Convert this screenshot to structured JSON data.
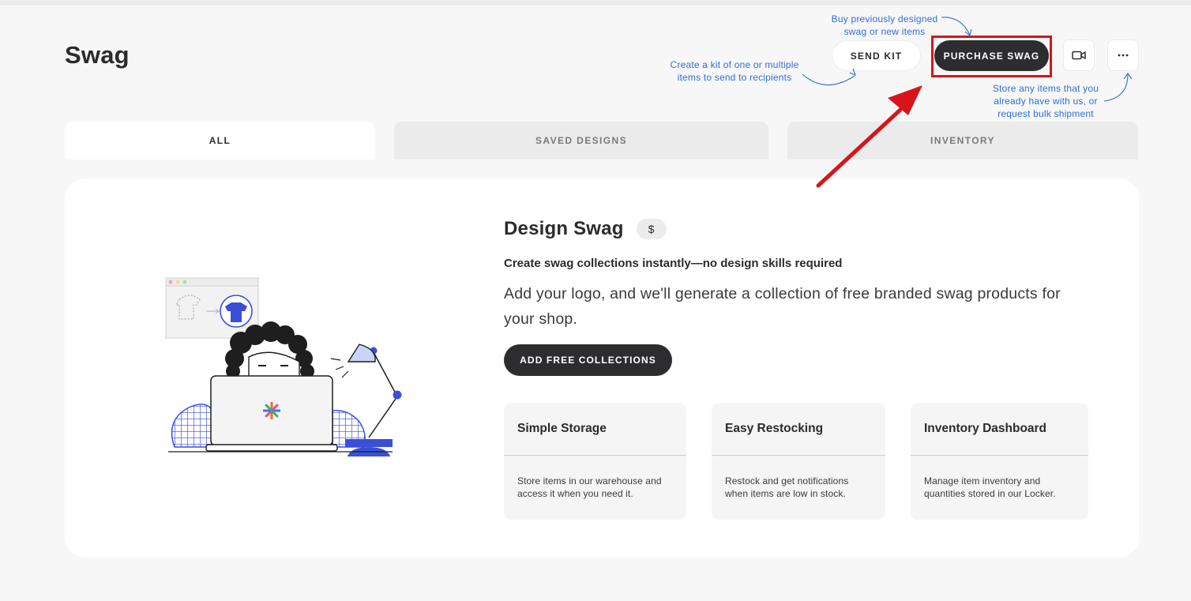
{
  "page": {
    "title": "Swag"
  },
  "hints": {
    "send_kit": "Create a kit of one or multiple items to send to recipients",
    "purchase": "Buy previously designed swag or new items",
    "more": "Store any items that you already have with us, or request bulk shipment"
  },
  "header": {
    "send_kit_label": "SEND KIT",
    "purchase_label": "PURCHASE SWAG",
    "video_icon": "video-camera-icon",
    "more_icon": "ellipsis-icon"
  },
  "tabs": [
    {
      "label": "ALL",
      "active": true
    },
    {
      "label": "SAVED DESIGNS",
      "active": false
    },
    {
      "label": "INVENTORY",
      "active": false
    }
  ],
  "main": {
    "title": "Design Swag",
    "badge": "$",
    "subtitle": "Create swag collections instantly—no design skills required",
    "description": "Add your logo, and we'll generate a collection of free branded swag products for your shop.",
    "cta_label": "ADD FREE COLLECTIONS"
  },
  "features": [
    {
      "title": "Simple Storage",
      "text": "Store items in our warehouse and access it when you need it."
    },
    {
      "title": "Easy Restocking",
      "text": "Restock and get notifications when items are low in stock."
    },
    {
      "title": "Inventory Dashboard",
      "text": "Manage item inventory and quantities stored in our Locker."
    }
  ],
  "colors": {
    "accent_dark": "#2d2d2f",
    "hint_blue": "#2f6fd6",
    "highlight_red": "#d8141a",
    "illustration_blue": "#3a4fd8"
  }
}
